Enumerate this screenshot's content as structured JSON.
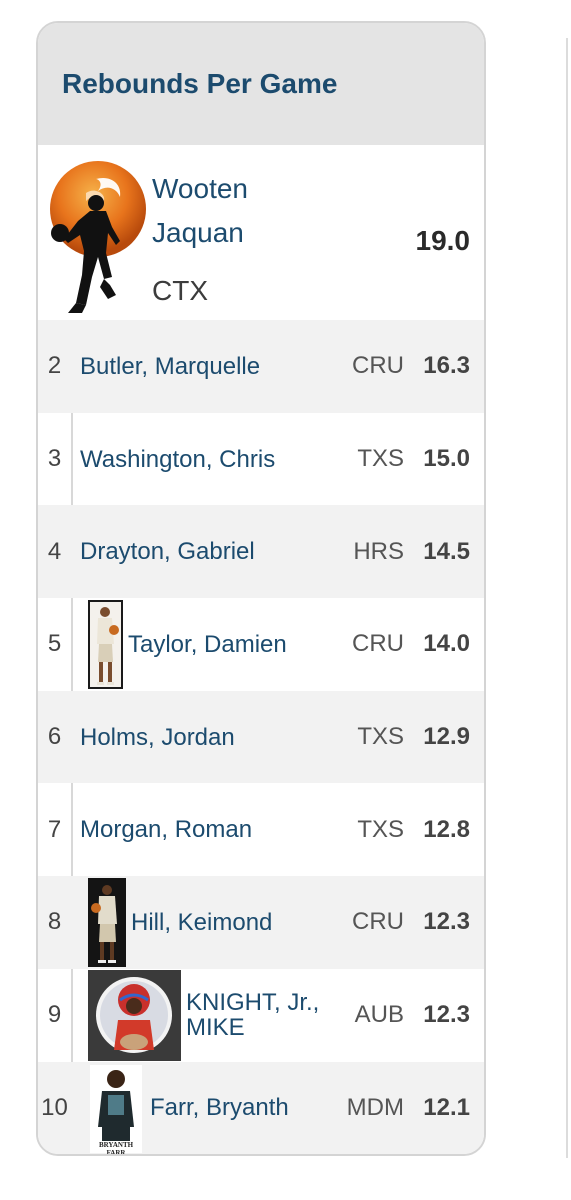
{
  "leaderboard": {
    "title": "Rebounds Per Game",
    "leader": {
      "first_line": "Wooten",
      "second_line": "Jaquan",
      "team": "CTX",
      "value": "19.0",
      "avatar": "basketball-player-silhouette-icon"
    },
    "rows": [
      {
        "rank": "2",
        "name": "Butler, Marquelle",
        "team": "CRU",
        "value": "16.3",
        "photo": false
      },
      {
        "rank": "3",
        "name": "Washington, Chris",
        "team": "TXS",
        "value": "15.0",
        "photo": false
      },
      {
        "rank": "4",
        "name": "Drayton, Gabriel",
        "team": "HRS",
        "value": "14.5",
        "photo": false
      },
      {
        "rank": "5",
        "name": "Taylor, Damien",
        "team": "CRU",
        "value": "14.0",
        "photo": true
      },
      {
        "rank": "6",
        "name": "Holms, Jordan",
        "team": "TXS",
        "value": "12.9",
        "photo": false
      },
      {
        "rank": "7",
        "name": "Morgan, Roman",
        "team": "TXS",
        "value": "12.8",
        "photo": false
      },
      {
        "rank": "8",
        "name": "Hill, Keimond",
        "team": "CRU",
        "value": "12.3",
        "photo": true
      },
      {
        "rank": "9",
        "name_line1": "KNIGHT, Jr.,",
        "name_line2": "MIKE",
        "team": "AUB",
        "value": "12.3",
        "photo": true
      },
      {
        "rank": "10",
        "name": "Farr, Bryanth",
        "team": "MDM",
        "value": "12.1",
        "photo": true,
        "photo_caption": "BRYANTH FARR"
      }
    ]
  },
  "colors": {
    "title": "#1c4b6e",
    "header_bg": "#e4e4e4",
    "row_shade": "#f2f2f2",
    "logo_orange": "#e8741c"
  }
}
